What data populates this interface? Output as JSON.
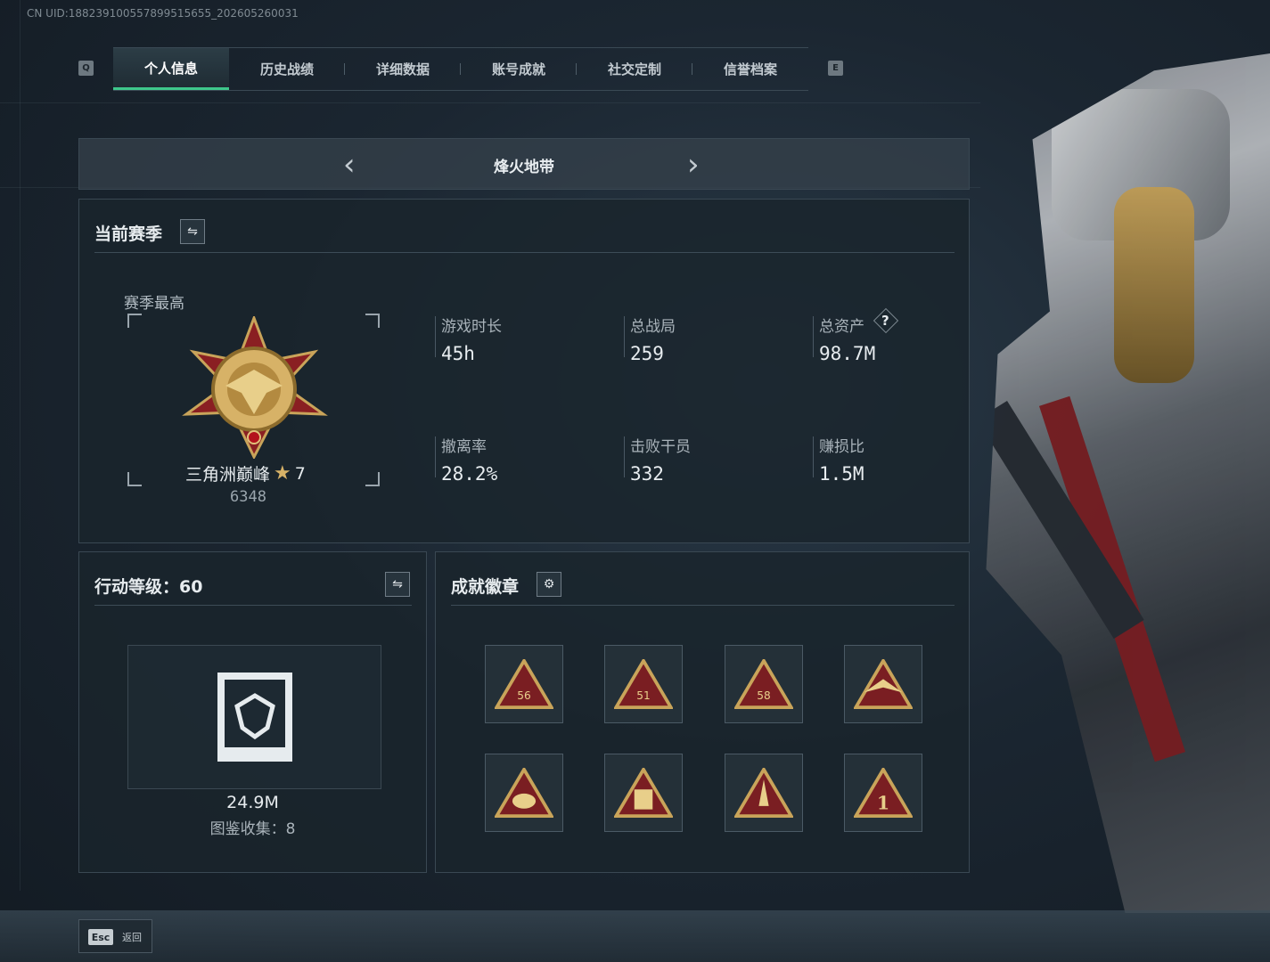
{
  "uid_text": "CN UID:18823910055789951565​5_202605260031",
  "tabs": [
    {
      "label": "个人信息",
      "active": true
    },
    {
      "label": "历史战绩",
      "active": false
    },
    {
      "label": "详细数据",
      "active": false
    },
    {
      "label": "账号成就",
      "active": false
    },
    {
      "label": "社交定制",
      "active": false
    },
    {
      "label": "信誉档案",
      "active": false
    }
  ],
  "tab_prev_key": "Q",
  "tab_next_key": "E",
  "mode_title": "烽火地带",
  "season": {
    "title": "当前赛季",
    "best_label": "赛季最高",
    "rank_name": "三角洲巅峰",
    "rank_stars": "7",
    "rank_score": "6348",
    "stats": [
      {
        "label": "游戏时长",
        "value": "45h"
      },
      {
        "label": "总战局",
        "value": "259"
      },
      {
        "label": "总资产",
        "value": "98.7M"
      },
      {
        "label": "撤离率",
        "value": "28.2%"
      },
      {
        "label": "击败干员",
        "value": "332"
      },
      {
        "label": "赚损比",
        "value": "1.5M"
      }
    ]
  },
  "action": {
    "title": "行动等级：60",
    "collection_value": "24.9M",
    "collection_label": "图鉴收集：8"
  },
  "achievements": {
    "title": "成就徽章",
    "badges": [
      {
        "icon": "badge-56-icon",
        "text": "56"
      },
      {
        "icon": "badge-51-icon",
        "text": "51"
      },
      {
        "icon": "badge-58-icon",
        "text": "58"
      },
      {
        "icon": "badge-winged-icon",
        "text": ""
      },
      {
        "icon": "badge-shell-icon",
        "text": ""
      },
      {
        "icon": "badge-soldiers-icon",
        "text": ""
      },
      {
        "icon": "badge-rocket-icon",
        "text": ""
      },
      {
        "icon": "badge-number-one-icon",
        "text": "1"
      }
    ]
  },
  "footer": {
    "esc_key": "Esc",
    "back_label": "返回"
  },
  "colors": {
    "accent": "#3ec78b",
    "badge_red": "#7a1e22",
    "badge_gold": "#c9a45a"
  }
}
